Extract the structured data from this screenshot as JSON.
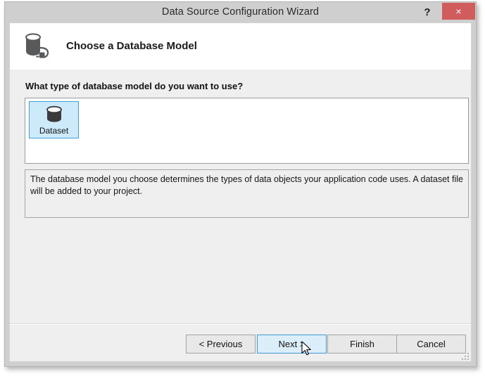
{
  "window": {
    "title": "Data Source Configuration Wizard",
    "help_label": "?",
    "close_label": "×"
  },
  "header": {
    "title": "Choose a Database Model",
    "icon": "database-connection-icon"
  },
  "main": {
    "question": "What type of database model do you want to use?",
    "models": [
      {
        "label": "Dataset",
        "icon": "database-cylinder-icon",
        "selected": true
      }
    ],
    "description": "The database model you choose determines the types of data objects your application code uses. A dataset file will be added to your project."
  },
  "footer": {
    "buttons": [
      {
        "label": "< Previous",
        "state": "normal"
      },
      {
        "label": "Next >",
        "state": "hover"
      },
      {
        "label": "Finish",
        "state": "normal"
      },
      {
        "label": "Cancel",
        "state": "normal"
      }
    ]
  },
  "colors": {
    "titlebar": "#cfcfcf",
    "close_button": "#d05c5c",
    "selection_fill": "#cdeafa",
    "selection_border": "#42a0d8",
    "hover_fill": "#ddeefb",
    "hover_border": "#3c99d4",
    "body_background": "#efefef"
  }
}
